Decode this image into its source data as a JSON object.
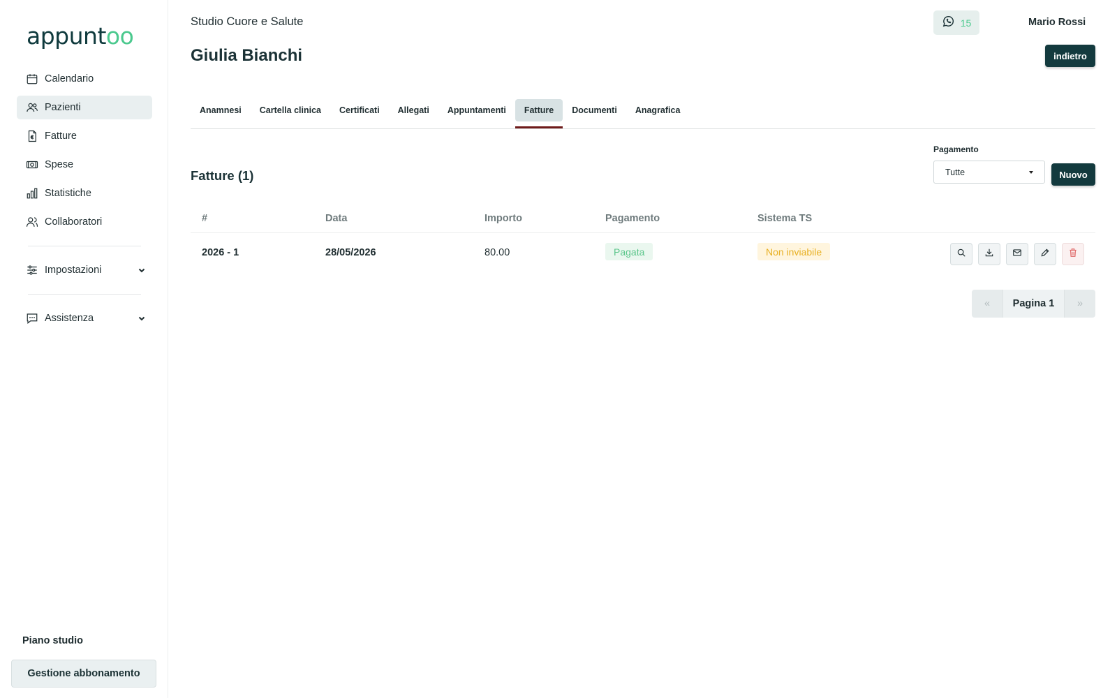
{
  "app": {
    "logo_prefix": "appunt",
    "logo_suffix": "oo"
  },
  "sidebar": {
    "items": [
      {
        "label": "Calendario",
        "icon": "calendar-icon"
      },
      {
        "label": "Pazienti",
        "icon": "users-icon",
        "active": true
      },
      {
        "label": "Fatture",
        "icon": "invoice-euro-icon"
      },
      {
        "label": "Spese",
        "icon": "banknote-icon"
      },
      {
        "label": "Statistiche",
        "icon": "bar-chart-icon"
      },
      {
        "label": "Collaboratori",
        "icon": "collaborators-icon"
      }
    ],
    "settings_label": "Impostazioni",
    "support_label": "Assistenza",
    "plan_title": "Piano studio",
    "plan_button": "Gestione abbonamento"
  },
  "header": {
    "studio_name": "Studio Cuore e Salute",
    "whatsapp_count": "15",
    "user_name": "Mario Rossi",
    "patient_name": "Giulia Bianchi",
    "back_label": "indietro"
  },
  "tabs": [
    {
      "label": "Anamnesi"
    },
    {
      "label": "Cartella clinica"
    },
    {
      "label": "Certificati"
    },
    {
      "label": "Allegati"
    },
    {
      "label": "Appuntamenti"
    },
    {
      "label": "Fatture",
      "active": true
    },
    {
      "label": "Documenti"
    },
    {
      "label": "Anagrafica"
    }
  ],
  "invoices": {
    "title": "Fatture (1)",
    "filter_label": "Pagamento",
    "filter_value": "Tutte",
    "new_label": "Nuovo",
    "columns": [
      "#",
      "Data",
      "Importo",
      "Pagamento",
      "Sistema TS"
    ],
    "rows": [
      {
        "number": "2026 - 1",
        "date": "28/05/2026",
        "amount": "80.00",
        "payment": "Pagata",
        "ts": "Non inviabile"
      }
    ]
  },
  "pagination": {
    "prev": "«",
    "current": "Pagina 1",
    "next": "»"
  },
  "colors": {
    "primary": "#133a3e",
    "accent_green": "#4bc98e",
    "badge_paid": "#5cc68b",
    "badge_warning": "#e8b023",
    "danger": "#e06b6b"
  }
}
